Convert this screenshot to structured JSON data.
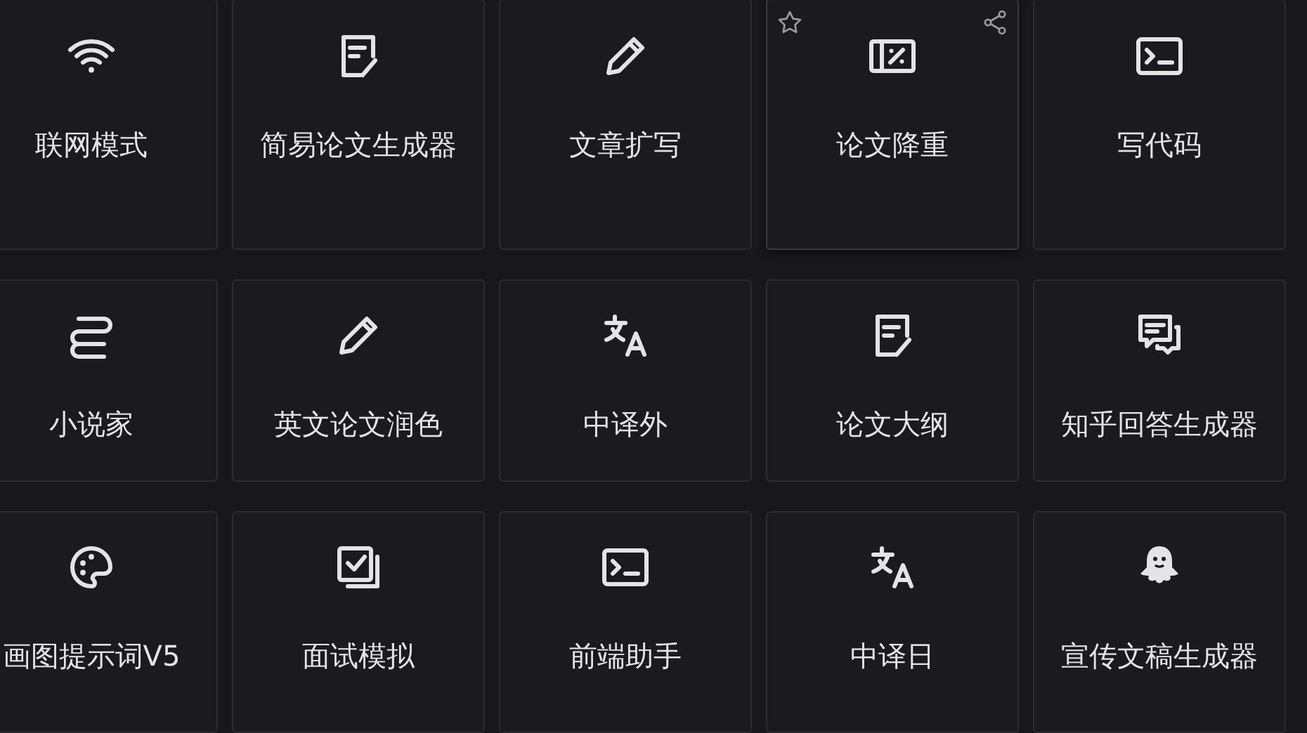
{
  "rows": [
    {
      "cards": [
        {
          "label": "联网模式",
          "hovered": false
        },
        {
          "label": "简易论文生成器",
          "hovered": false
        },
        {
          "label": "文章扩写",
          "hovered": false
        },
        {
          "label": "论文降重",
          "hovered": true
        },
        {
          "label": "写代码",
          "hovered": false
        }
      ]
    },
    {
      "cards": [
        {
          "label": "小说家",
          "hovered": false
        },
        {
          "label": "英文论文润色",
          "hovered": false
        },
        {
          "label": "中译外",
          "hovered": false
        },
        {
          "label": "论文大纲",
          "hovered": false
        },
        {
          "label": "知乎回答生成器",
          "hovered": false
        }
      ]
    },
    {
      "cards": [
        {
          "label": "画图提示词V5",
          "hovered": false
        },
        {
          "label": "面试模拟",
          "hovered": false
        },
        {
          "label": "前端助手",
          "hovered": false
        },
        {
          "label": "中译日",
          "hovered": false
        },
        {
          "label": "宣传文稿生成器",
          "hovered": false
        }
      ]
    }
  ]
}
